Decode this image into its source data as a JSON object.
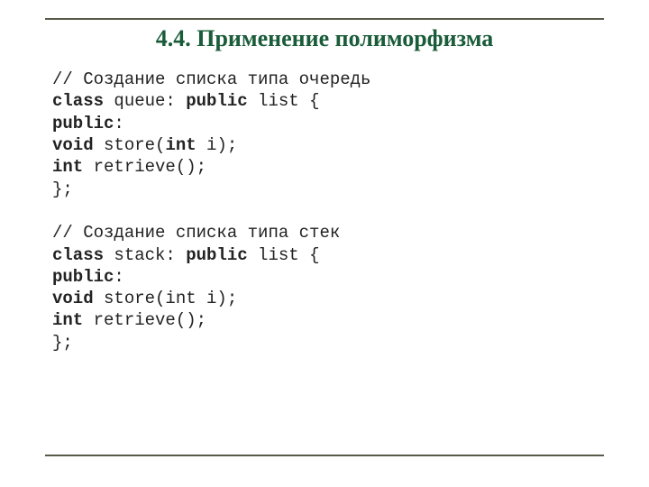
{
  "title": "4.4. Применение полиморфизма",
  "code": {
    "c1": "// Создание списка типа очередь",
    "kw_class1": "class",
    "t_queue": " queue: ",
    "kw_public1": "public",
    "t_list1": " list {",
    "kw_public2": "public",
    "t_colon1": ":",
    "kw_void1": "void",
    "t_store1": " store(",
    "kw_int_param1": "int",
    "t_store1b": " i);",
    "kw_int1": "int",
    "t_retr1": " retrieve();",
    "t_close1": "};",
    "blank": "",
    "c2": "// Создание списка типа стек",
    "kw_class2": "class",
    "t_stack": " stack: ",
    "kw_public3": "public",
    "t_list2": " list {",
    "kw_public4": "public",
    "t_colon2": ":",
    "kw_void2": "void",
    "t_store2": " store(int i);",
    "kw_int2": "int",
    "t_retr2": " retrieve();",
    "t_close2": "};"
  }
}
